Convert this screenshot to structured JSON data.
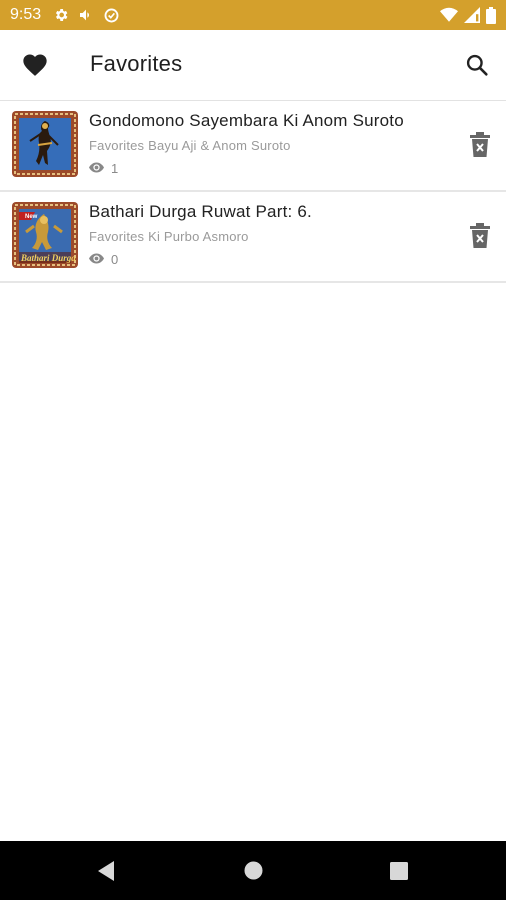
{
  "status_bar": {
    "time": "9:53",
    "background": "#d4a02c",
    "icons_left": [
      "settings-icon",
      "volume-icon",
      "data-saver-icon"
    ],
    "icons_right": [
      "wifi-icon",
      "signal-icon",
      "battery-icon"
    ]
  },
  "app_bar": {
    "title": "Favorites",
    "leading_icon": "heart-icon",
    "action_icon": "search-icon"
  },
  "favorites": [
    {
      "title": "Gondomono Sayembara   Ki Anom Suroto",
      "subtitle": "Favorites Bayu Aji & Anom Suroto",
      "views": "1",
      "thumbnail": "wayang-puppet-thumbnail"
    },
    {
      "title": "Bathari Durga Ruwat Part: 6.",
      "subtitle": "Favorites Ki Purbo Asmoro",
      "views": "0",
      "thumbnail": "bathari-durga-thumbnail",
      "thumbnail_badge": "New",
      "thumbnail_caption": "Bathari Durga"
    }
  ],
  "nav_bar": {
    "buttons": [
      "back-button",
      "home-button",
      "recents-button"
    ]
  }
}
